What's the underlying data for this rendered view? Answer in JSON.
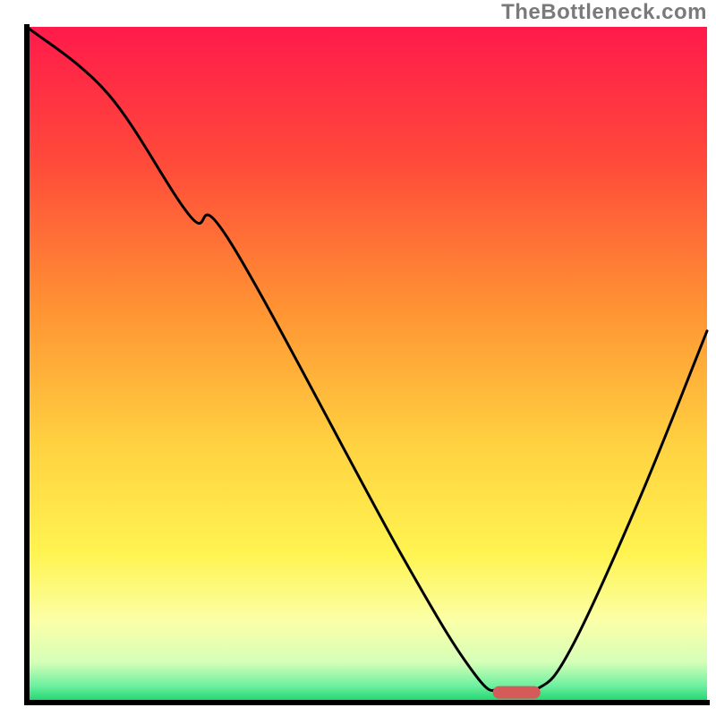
{
  "watermark": "TheBottleneck.com",
  "chart_data": {
    "type": "line",
    "title": "",
    "xlabel": "",
    "ylabel": "",
    "xlim": [
      0,
      100
    ],
    "ylim": [
      0,
      100
    ],
    "background_gradient_stops": [
      {
        "offset": 0.0,
        "color": "#ff1a4b"
      },
      {
        "offset": 0.2,
        "color": "#ff4a3a"
      },
      {
        "offset": 0.42,
        "color": "#ff9433"
      },
      {
        "offset": 0.62,
        "color": "#ffd241"
      },
      {
        "offset": 0.78,
        "color": "#fff451"
      },
      {
        "offset": 0.88,
        "color": "#fbffa8"
      },
      {
        "offset": 0.94,
        "color": "#d6ffb8"
      },
      {
        "offset": 0.975,
        "color": "#6ef0a0"
      },
      {
        "offset": 1.0,
        "color": "#18d36a"
      }
    ],
    "series": [
      {
        "name": "bottleneck-curve",
        "x": [
          0,
          12,
          24,
          30,
          55,
          66,
          70,
          75,
          80,
          90,
          100
        ],
        "y": [
          100,
          90,
          72,
          68,
          22,
          4,
          2,
          2,
          8,
          30,
          55
        ]
      }
    ],
    "marker": {
      "name": "optimal-range",
      "x_center": 72,
      "y": 1.5,
      "width": 7,
      "color": "#d55a5a"
    },
    "axes_color": "#000000",
    "curve_color": "#000000"
  }
}
